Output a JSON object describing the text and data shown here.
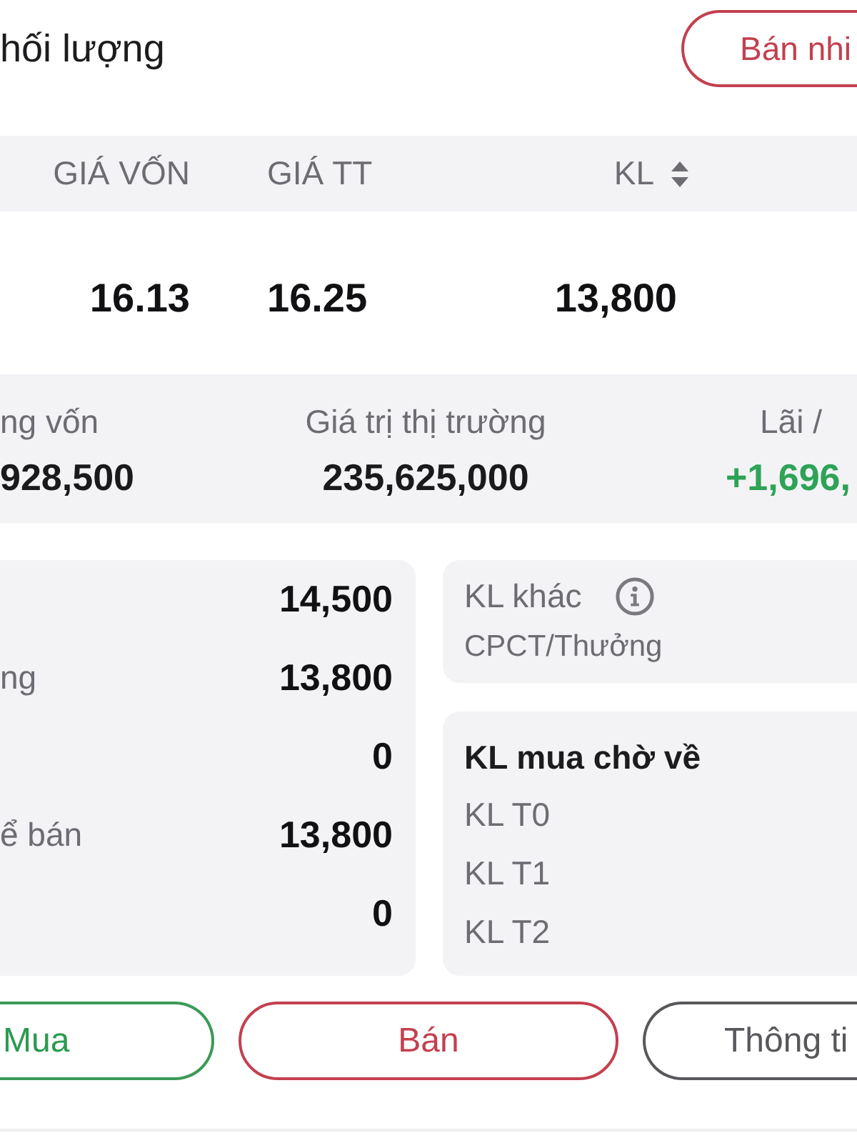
{
  "header": {
    "title": "hối lượng",
    "action_button": "Bán nhi"
  },
  "table": {
    "columns": [
      {
        "label": "GIÁ VỐN",
        "sortable": false
      },
      {
        "label": "GIÁ TT",
        "sortable": false
      },
      {
        "label": "KL",
        "sortable": true
      }
    ],
    "rows": [
      [
        "16.13",
        "16.25",
        "13,800"
      ]
    ]
  },
  "summary": [
    {
      "label": "ng vốn",
      "value": "928,500",
      "kind": "neutral"
    },
    {
      "label": "Giá trị thị trường",
      "value": "235,625,000",
      "kind": "neutral"
    },
    {
      "label": "Lãi /",
      "value": "+1,696,",
      "kind": "gain"
    }
  ],
  "holdings": [
    {
      "value": "14,500"
    },
    {
      "label": "ng",
      "value": "13,800"
    },
    {
      "value": "0"
    },
    {
      "label": "ể bán",
      "value": "13,800"
    },
    {
      "value": "0"
    }
  ],
  "other_volume": {
    "title": "KL khác",
    "items": [
      "CPCT/Thưởng"
    ]
  },
  "pending_buy": {
    "title": "KL mua chờ về",
    "items": [
      "KL T0",
      "KL T1",
      "KL T2"
    ]
  },
  "actions": [
    {
      "label": "Mua",
      "kind": "buy"
    },
    {
      "label": "Bán",
      "kind": "sell"
    },
    {
      "label": "Thông ti",
      "kind": "info"
    }
  ]
}
